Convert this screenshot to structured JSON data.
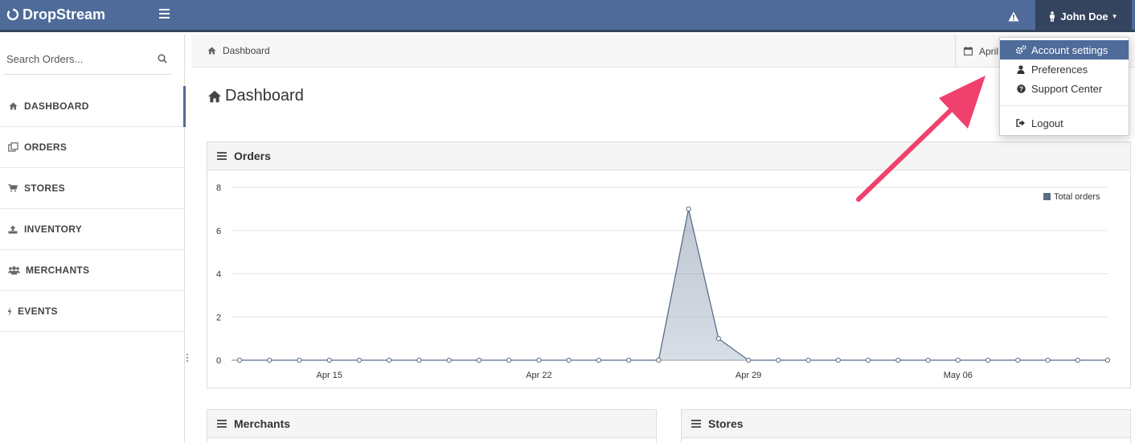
{
  "app": {
    "name": "DropStream"
  },
  "topbar": {
    "user_name": "John Doe"
  },
  "sidebar": {
    "search": {
      "placeholder": "Search Orders..."
    },
    "items": [
      {
        "label": "DASHBOARD",
        "icon": "home-icon"
      },
      {
        "label": "ORDERS",
        "icon": "orders-icon"
      },
      {
        "label": "STORES",
        "icon": "cart-icon"
      },
      {
        "label": "INVENTORY",
        "icon": "upload-icon"
      },
      {
        "label": "MERCHANTS",
        "icon": "users-icon"
      },
      {
        "label": "EVENTS",
        "icon": "bolt-icon"
      }
    ]
  },
  "breadcrumb": {
    "label": "Dashboard"
  },
  "date_range": {
    "label": "April"
  },
  "page": {
    "title": "Dashboard"
  },
  "panels": {
    "orders": "Orders",
    "merchants": "Merchants",
    "stores": "Stores"
  },
  "user_menu": {
    "items": [
      {
        "label": "Account settings",
        "icon": "gears-icon",
        "active": true
      },
      {
        "label": "Preferences",
        "icon": "user-icon"
      },
      {
        "label": "Support Center",
        "icon": "question-icon"
      },
      {
        "label": "Logout",
        "icon": "sign-out-icon"
      }
    ]
  },
  "colors": {
    "brand": "#4e6b9a",
    "brand_dark": "#34445e",
    "series": "#5a6e89",
    "annotation": "#f0416e"
  },
  "chart_data": {
    "type": "area",
    "title": "",
    "xlabel": "",
    "ylabel": "",
    "ylim": [
      0,
      8
    ],
    "yticks": [
      0,
      2,
      4,
      6,
      8
    ],
    "x_tick_labels": [
      {
        "label": "Apr 15",
        "index": 3
      },
      {
        "label": "Apr 22",
        "index": 10
      },
      {
        "label": "Apr 29",
        "index": 17
      },
      {
        "label": "May 06",
        "index": 24
      }
    ],
    "x": [
      "Apr 12",
      "Apr 13",
      "Apr 14",
      "Apr 15",
      "Apr 16",
      "Apr 17",
      "Apr 18",
      "Apr 19",
      "Apr 20",
      "Apr 21",
      "Apr 22",
      "Apr 23",
      "Apr 24",
      "Apr 25",
      "Apr 26",
      "Apr 27",
      "Apr 28",
      "Apr 29",
      "Apr 30",
      "May 01",
      "May 02",
      "May 03",
      "May 04",
      "May 05",
      "May 06",
      "May 07",
      "May 08",
      "May 09",
      "May 10",
      "May 11"
    ],
    "series": [
      {
        "name": "Total orders",
        "values": [
          0,
          0,
          0,
          0,
          0,
          0,
          0,
          0,
          0,
          0,
          0,
          0,
          0,
          0,
          0,
          7,
          1,
          0,
          0,
          0,
          0,
          0,
          0,
          0,
          0,
          0,
          0,
          0,
          0,
          0
        ]
      }
    ],
    "legend_position": "top-right",
    "grid": true
  }
}
